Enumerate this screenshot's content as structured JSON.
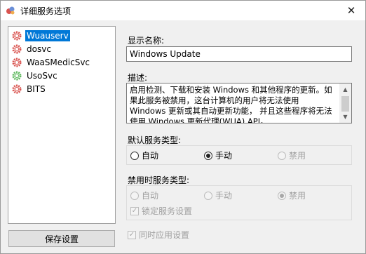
{
  "window": {
    "title": "详细服务选项",
    "close_glyph": "✕"
  },
  "services": [
    {
      "name": "Wuauserv",
      "selected": true,
      "icon": "gear-red-icon"
    },
    {
      "name": "dosvc",
      "selected": false,
      "icon": "gear-red-icon"
    },
    {
      "name": "WaaSMedicSvc",
      "selected": false,
      "icon": "gear-red-icon"
    },
    {
      "name": "UsoSvc",
      "selected": false,
      "icon": "gear-green-icon"
    },
    {
      "name": "BITS",
      "selected": false,
      "icon": "gear-red-icon"
    }
  ],
  "save_button": "保存设置",
  "display_name": {
    "label": "显示名称:",
    "value": "Windows Update"
  },
  "description": {
    "label": "描述:",
    "text": "启用检测、下载和安装 Windows 和其他程序的更新。如果此服务被禁用，这台计算机的用户将无法使用 Windows 更新或其自动更新功能， 并且这些程序将无法使用 Windows 更新代理(WUA) API。"
  },
  "default_type": {
    "label": "默认服务类型:",
    "options": [
      {
        "label": "自动",
        "checked": false,
        "disabled": false
      },
      {
        "label": "手动",
        "checked": true,
        "disabled": false
      },
      {
        "label": "禁用",
        "checked": false,
        "disabled": true
      }
    ]
  },
  "disabled_type": {
    "label": "禁用时服务类型:",
    "options": [
      {
        "label": "自动",
        "checked": false,
        "disabled": true
      },
      {
        "label": "手动",
        "checked": false,
        "disabled": true
      },
      {
        "label": "禁用",
        "checked": true,
        "disabled": true
      }
    ],
    "lock_label": "锁定服务设置",
    "lock_checked": true
  },
  "apply_together": {
    "label": "同时应用设置",
    "checked": true
  },
  "colors": {
    "selection": "#0078d7",
    "gear_red": "#d9534f",
    "gear_green": "#5cb85c"
  }
}
